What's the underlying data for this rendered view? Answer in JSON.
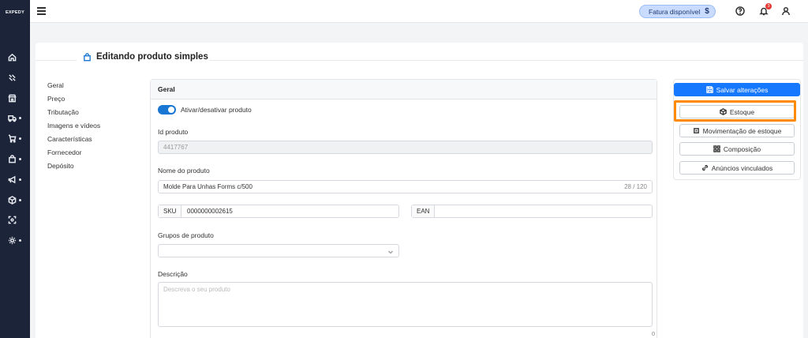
{
  "app": {
    "logo_text": "EXPEDY"
  },
  "topbar": {
    "invoice_label": "Fatura disponível",
    "invoice_icon": "$",
    "notification_count": "3"
  },
  "page": {
    "title": "Editando produto simples"
  },
  "left_menu": {
    "items": [
      "Geral",
      "Preço",
      "Tributação",
      "Imagens e vídeos",
      "Características",
      "Fornecedor",
      "Depósito"
    ]
  },
  "form": {
    "section_title": "Geral",
    "toggle_label": "Ativar/desativar produto",
    "id_label": "Id produto",
    "id_value": "4417767",
    "name_label": "Nome do produto",
    "name_value": "Molde Para Unhas Forms c/500",
    "name_counter": "28 / 120",
    "sku_label": "SKU",
    "sku_value": "0000000002615",
    "ean_label": "EAN",
    "ean_value": "",
    "groups_label": "Grupos de produto",
    "groups_value": "",
    "description_label": "Descrição",
    "description_placeholder": "Descreva o seu produto",
    "description_counter": "0"
  },
  "actions": {
    "save_label": "Salvar alterações",
    "stock_label": "Estoque",
    "stock_movement_label": "Movimentação de estoque",
    "composition_label": "Composição",
    "linked_ads_label": "Anúncios vinculados"
  },
  "colors": {
    "sidebar_bg": "#1b2438",
    "primary": "#1677ff",
    "highlight": "#ff8a00"
  }
}
